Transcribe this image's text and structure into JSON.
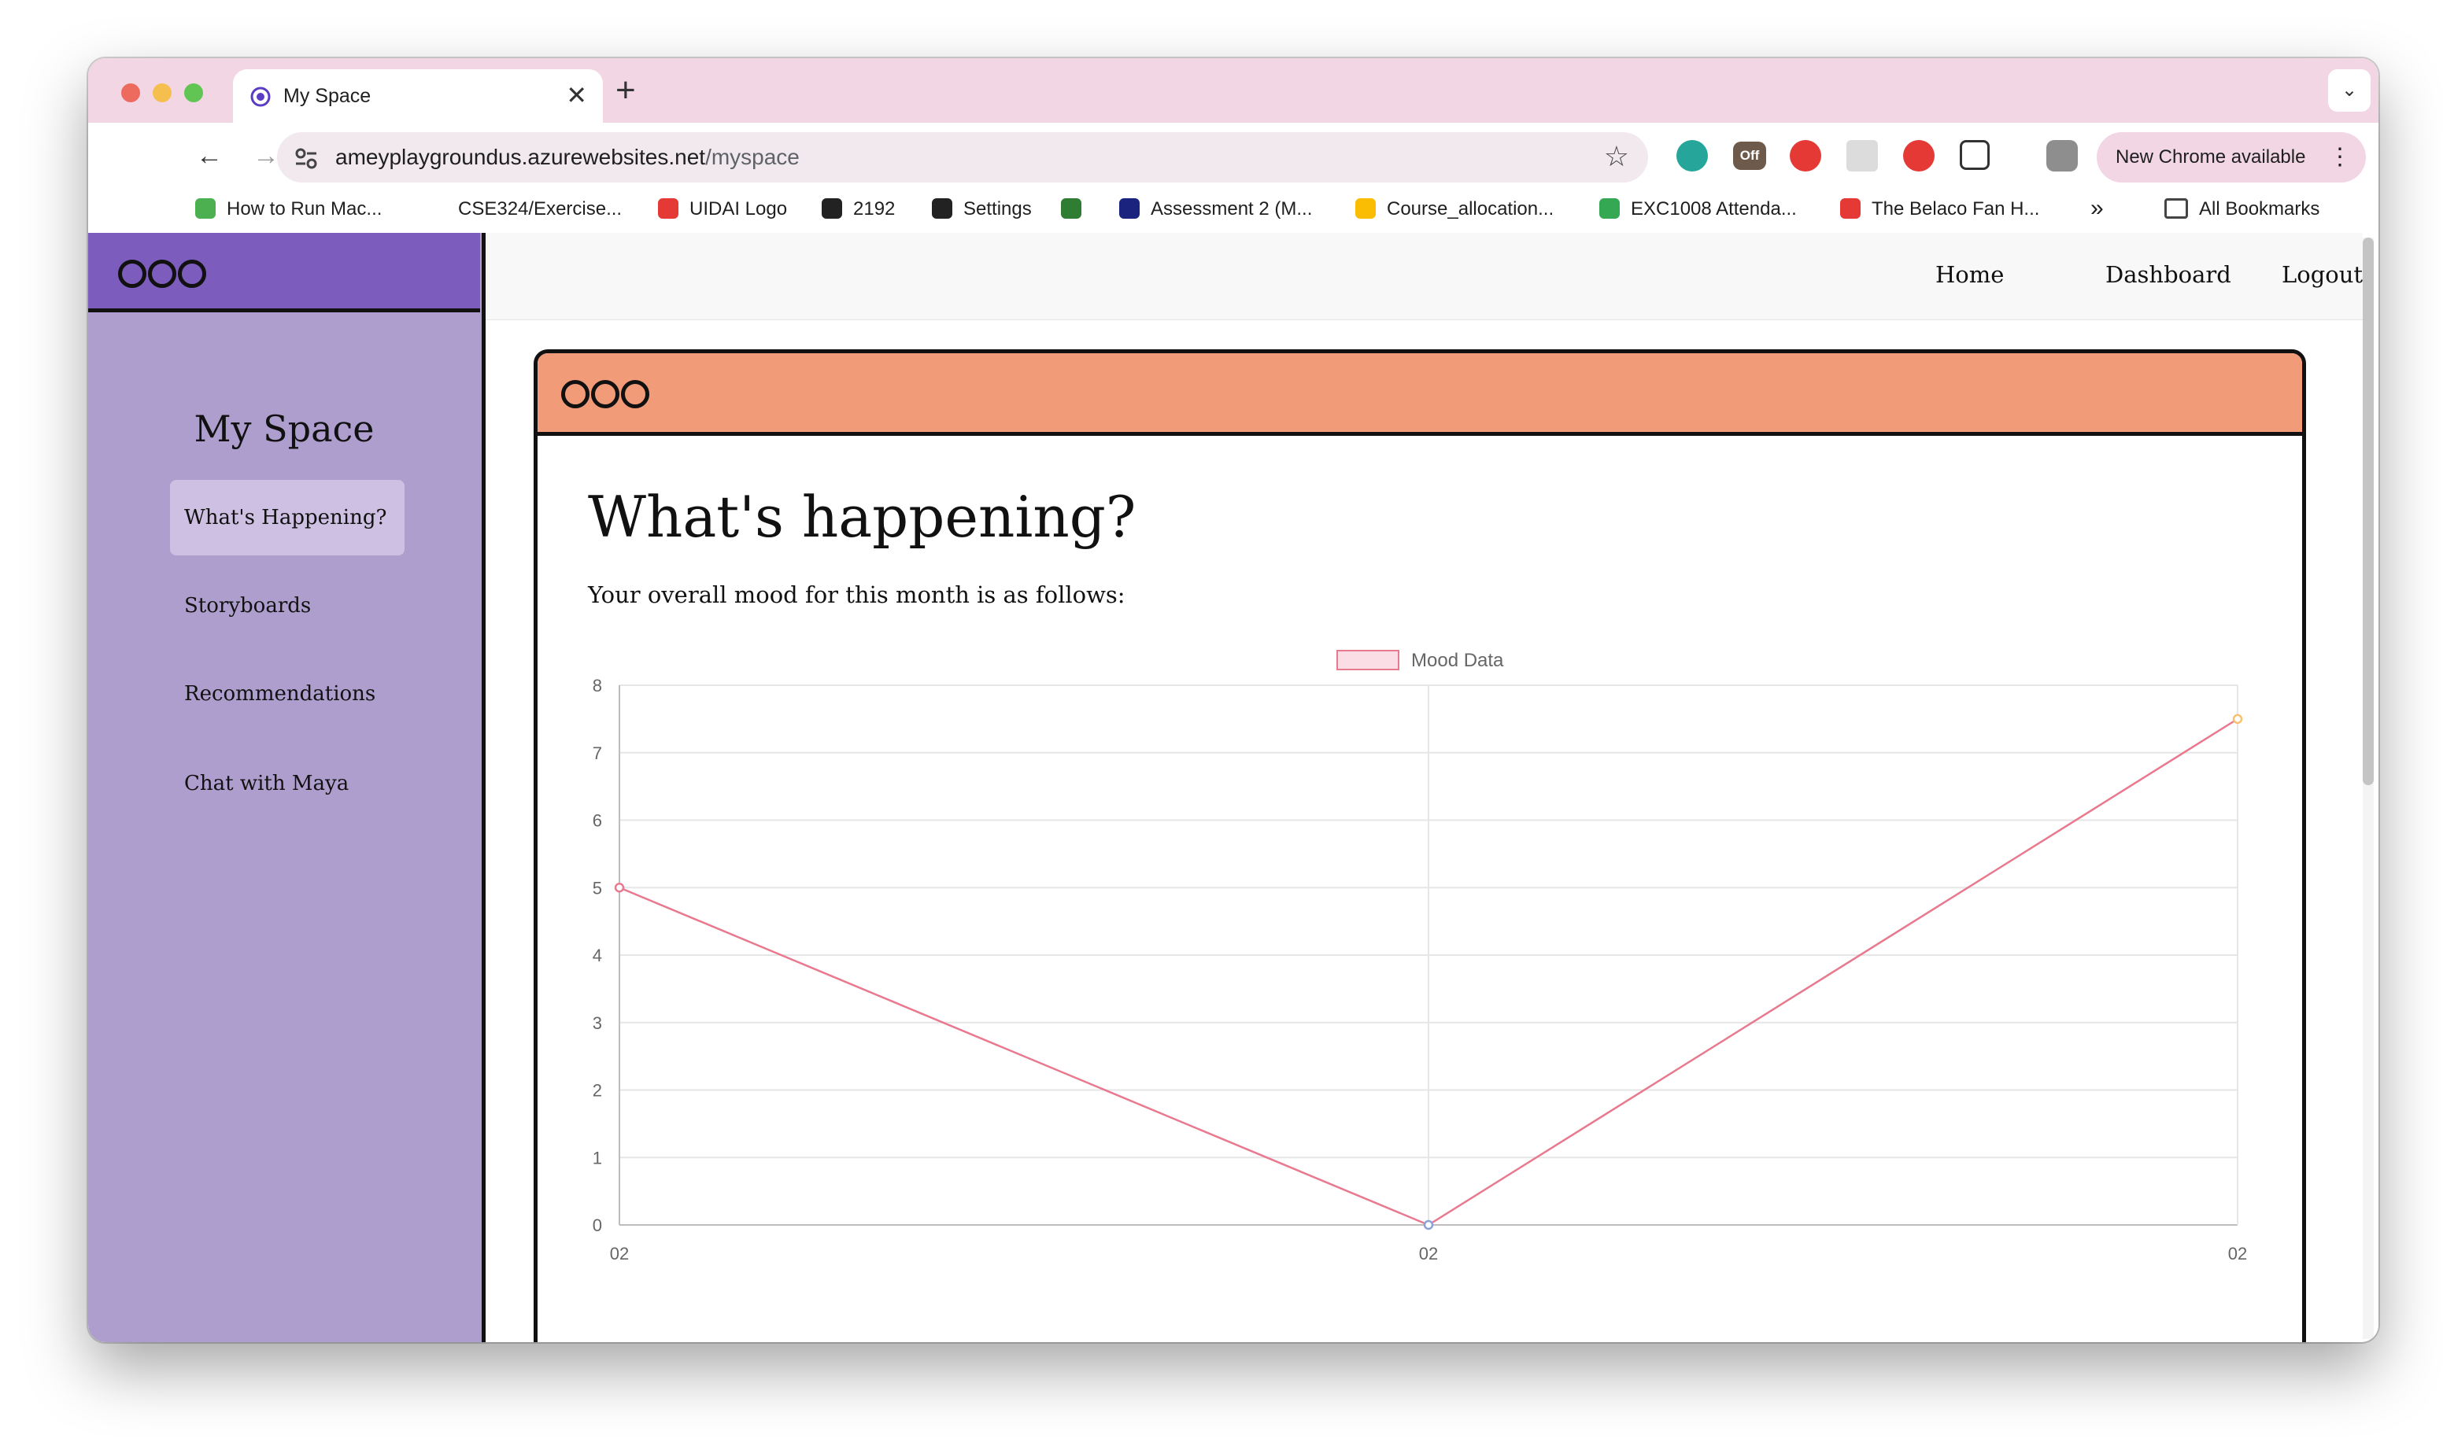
{
  "browser": {
    "tab_title": "My Space",
    "url_host": "ameyplaygroundus.azurewebsites.net",
    "url_path": "/myspace",
    "new_chrome_label": "New Chrome available",
    "ext_off_badge": "Off",
    "all_bookmarks": "All Bookmarks",
    "bookmarks": [
      {
        "label": "How to Run Mac...",
        "color": "#4caf50"
      },
      {
        "label": "CSE324/Exercise...",
        "color": ""
      },
      {
        "label": "UIDAI Logo",
        "color": "#e53935"
      },
      {
        "label": "2192",
        "color": "#222222"
      },
      {
        "label": "Settings",
        "color": "#222222"
      },
      {
        "label": "",
        "color": "#2e7d32"
      },
      {
        "label": "Assessment 2 (M...",
        "color": "#1a237e"
      },
      {
        "label": "Course_allocation...",
        "color": "#fbbc04"
      },
      {
        "label": "EXC1008 Attenda...",
        "color": "#34a853"
      },
      {
        "label": "The Belaco Fan H...",
        "color": "#e53935"
      }
    ]
  },
  "app": {
    "sidebar": {
      "title": "My Space",
      "items": [
        "What's Happening?",
        "Storyboards",
        "Recommendations",
        "Chat with Maya"
      ]
    },
    "topnav": {
      "home": "Home",
      "dashboard": "Dashboard",
      "logout": "Logout"
    },
    "card": {
      "title": "What's happening?",
      "subtitle": "Your overall mood for this month is as follows:"
    },
    "colors": {
      "sidebar_bg": "#ae9ecd",
      "sidebar_head": "#7c5cbc",
      "card_head": "#f19b78",
      "chart_line": "#e8798e"
    }
  },
  "chart_data": {
    "type": "line",
    "categories": [
      "02",
      "02",
      "02"
    ],
    "series": [
      {
        "name": "Mood Data",
        "values": [
          5,
          0,
          7.5
        ],
        "point_colors": [
          "#e8798e",
          "#8aa2d8",
          "#f5c16f"
        ]
      }
    ],
    "ylim": [
      0,
      8
    ],
    "yticks": [
      "0",
      "1",
      "2",
      "3",
      "4",
      "5",
      "6",
      "7",
      "8"
    ],
    "grid": true,
    "legend": "top-center"
  }
}
